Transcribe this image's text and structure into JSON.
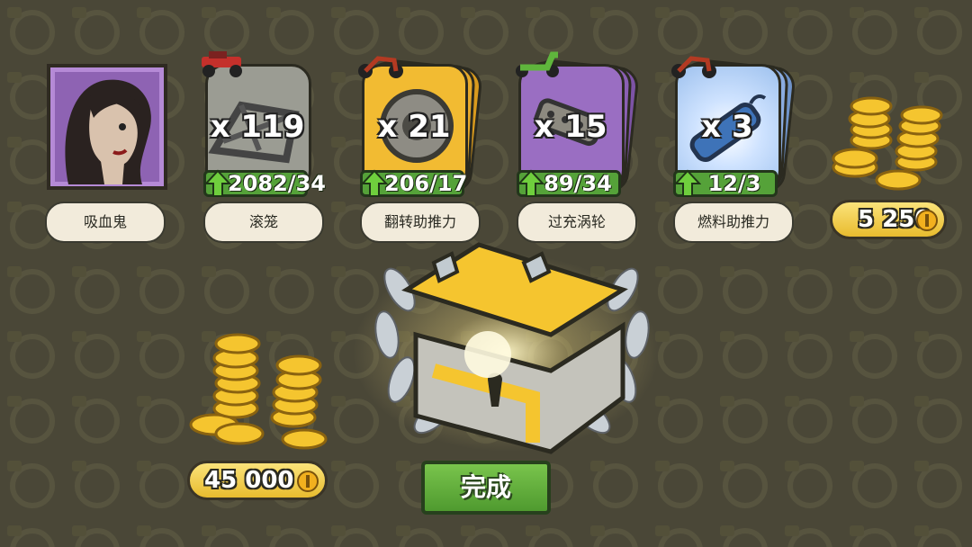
{
  "rewards": [
    {
      "name": "吸血鬼"
    },
    {
      "name": "滚笼",
      "quantity": "x 119",
      "progress": "2082/34"
    },
    {
      "name": "翻转助推力",
      "quantity": "x 21",
      "progress": "206/17"
    },
    {
      "name": "过充涡轮",
      "quantity": "x 15",
      "progress": "89/34"
    },
    {
      "name": "燃料助推力",
      "quantity": "x 3",
      "progress": "12/3"
    }
  ],
  "total_coins": "5 250",
  "earned_coins": "45 000",
  "done_button": "完成",
  "colors": {
    "background": "#4a4737",
    "button_green": "#5cab38",
    "coin_gold": "#f5c52f",
    "purple": "#8e63b3"
  }
}
